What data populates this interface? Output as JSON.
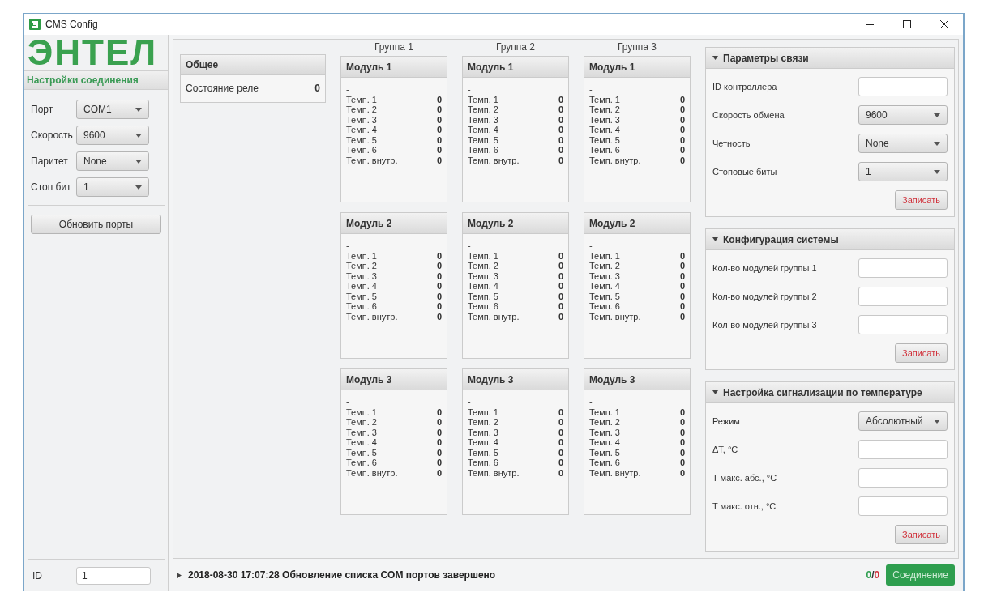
{
  "window": {
    "title": "CMS Config"
  },
  "logo": "ЭНТЕЛ",
  "connection": {
    "title": "Настройки соединения",
    "fields": [
      {
        "label": "Порт",
        "value": "COM1"
      },
      {
        "label": "Скорость",
        "value": "9600"
      },
      {
        "label": "Паритет",
        "value": "None"
      },
      {
        "label": "Стоп бит",
        "value": "1"
      }
    ],
    "refresh_button": "Обновить порты",
    "id_label": "ID",
    "id_value": "1"
  },
  "general": {
    "title": "Общее",
    "rows": [
      {
        "label": "Состояние реле",
        "value": "0"
      }
    ]
  },
  "groups": [
    {
      "title": "Группа 1",
      "modules": [
        {
          "title": "Модуль 1",
          "status": "-",
          "readings": [
            {
              "label": "Темп. 1",
              "value": "0"
            },
            {
              "label": "Темп. 2",
              "value": "0"
            },
            {
              "label": "Темп. 3",
              "value": "0"
            },
            {
              "label": "Темп. 4",
              "value": "0"
            },
            {
              "label": "Темп. 5",
              "value": "0"
            },
            {
              "label": "Темп. 6",
              "value": "0"
            },
            {
              "label": "Темп. внутр.",
              "value": "0"
            }
          ]
        },
        {
          "title": "Модуль 2",
          "status": "-",
          "readings": [
            {
              "label": "Темп. 1",
              "value": "0"
            },
            {
              "label": "Темп. 2",
              "value": "0"
            },
            {
              "label": "Темп. 3",
              "value": "0"
            },
            {
              "label": "Темп. 4",
              "value": "0"
            },
            {
              "label": "Темп. 5",
              "value": "0"
            },
            {
              "label": "Темп. 6",
              "value": "0"
            },
            {
              "label": "Темп. внутр.",
              "value": "0"
            }
          ]
        },
        {
          "title": "Модуль 3",
          "status": "-",
          "readings": [
            {
              "label": "Темп. 1",
              "value": "0"
            },
            {
              "label": "Темп. 2",
              "value": "0"
            },
            {
              "label": "Темп. 3",
              "value": "0"
            },
            {
              "label": "Темп. 4",
              "value": "0"
            },
            {
              "label": "Темп. 5",
              "value": "0"
            },
            {
              "label": "Темп. 6",
              "value": "0"
            },
            {
              "label": "Темп. внутр.",
              "value": "0"
            }
          ]
        }
      ]
    },
    {
      "title": "Группа 2",
      "modules": [
        {
          "title": "Модуль 1",
          "status": "-",
          "readings": [
            {
              "label": "Темп. 1",
              "value": "0"
            },
            {
              "label": "Темп. 2",
              "value": "0"
            },
            {
              "label": "Темп. 3",
              "value": "0"
            },
            {
              "label": "Темп. 4",
              "value": "0"
            },
            {
              "label": "Темп. 5",
              "value": "0"
            },
            {
              "label": "Темп. 6",
              "value": "0"
            },
            {
              "label": "Темп. внутр.",
              "value": "0"
            }
          ]
        },
        {
          "title": "Модуль 2",
          "status": "-",
          "readings": [
            {
              "label": "Темп. 1",
              "value": "0"
            },
            {
              "label": "Темп. 2",
              "value": "0"
            },
            {
              "label": "Темп. 3",
              "value": "0"
            },
            {
              "label": "Темп. 4",
              "value": "0"
            },
            {
              "label": "Темп. 5",
              "value": "0"
            },
            {
              "label": "Темп. 6",
              "value": "0"
            },
            {
              "label": "Темп. внутр.",
              "value": "0"
            }
          ]
        },
        {
          "title": "Модуль 3",
          "status": "-",
          "readings": [
            {
              "label": "Темп. 1",
              "value": "0"
            },
            {
              "label": "Темп. 2",
              "value": "0"
            },
            {
              "label": "Темп. 3",
              "value": "0"
            },
            {
              "label": "Темп. 4",
              "value": "0"
            },
            {
              "label": "Темп. 5",
              "value": "0"
            },
            {
              "label": "Темп. 6",
              "value": "0"
            },
            {
              "label": "Темп. внутр.",
              "value": "0"
            }
          ]
        }
      ]
    },
    {
      "title": "Группа 3",
      "modules": [
        {
          "title": "Модуль 1",
          "status": "-",
          "readings": [
            {
              "label": "Темп. 1",
              "value": "0"
            },
            {
              "label": "Темп. 2",
              "value": "0"
            },
            {
              "label": "Темп. 3",
              "value": "0"
            },
            {
              "label": "Темп. 4",
              "value": "0"
            },
            {
              "label": "Темп. 5",
              "value": "0"
            },
            {
              "label": "Темп. 6",
              "value": "0"
            },
            {
              "label": "Темп. внутр.",
              "value": "0"
            }
          ]
        },
        {
          "title": "Модуль 2",
          "status": "-",
          "readings": [
            {
              "label": "Темп. 1",
              "value": "0"
            },
            {
              "label": "Темп. 2",
              "value": "0"
            },
            {
              "label": "Темп. 3",
              "value": "0"
            },
            {
              "label": "Темп. 4",
              "value": "0"
            },
            {
              "label": "Темп. 5",
              "value": "0"
            },
            {
              "label": "Темп. 6",
              "value": "0"
            },
            {
              "label": "Темп. внутр.",
              "value": "0"
            }
          ]
        },
        {
          "title": "Модуль 3",
          "status": "-",
          "readings": [
            {
              "label": "Темп. 1",
              "value": "0"
            },
            {
              "label": "Темп. 2",
              "value": "0"
            },
            {
              "label": "Темп. 3",
              "value": "0"
            },
            {
              "label": "Темп. 4",
              "value": "0"
            },
            {
              "label": "Темп. 5",
              "value": "0"
            },
            {
              "label": "Темп. 6",
              "value": "0"
            },
            {
              "label": "Темп. внутр.",
              "value": "0"
            }
          ]
        }
      ]
    }
  ],
  "panels": [
    {
      "title": "Параметры связи",
      "expanded": true,
      "fields": [
        {
          "kind": "input",
          "label": "ID контроллера"
        },
        {
          "kind": "select",
          "label": "Скорость обмена",
          "value": "9600"
        },
        {
          "kind": "select",
          "label": "Четность",
          "value": "None"
        },
        {
          "kind": "select",
          "label": "Стоповые биты",
          "value": "1"
        }
      ],
      "button": "Записать"
    },
    {
      "title": "Конфигурация системы",
      "expanded": true,
      "fields": [
        {
          "kind": "input",
          "label": "Кол-во модулей группы 1"
        },
        {
          "kind": "input",
          "label": "Кол-во модулей группы 2"
        },
        {
          "kind": "input",
          "label": "Кол-во модулей группы 3"
        }
      ],
      "button": "Записать"
    },
    {
      "title": "Настройка сигнализации по температуре",
      "expanded": true,
      "fields": [
        {
          "kind": "select",
          "label": "Режим",
          "value": "Абсолютный"
        },
        {
          "kind": "input",
          "label": "ΔT, °C"
        },
        {
          "kind": "input",
          "label": "T макс. абс., °C"
        },
        {
          "kind": "input",
          "label": "T макс. отн., °C"
        }
      ],
      "button": "Записать"
    }
  ],
  "status_bar": {
    "expanded": false,
    "message": "2018-08-30 17:07:28 Обновление списка COM портов завершено",
    "counter_good": "0",
    "counter_separator": "/",
    "counter_bad": "0",
    "connect_button": "Соединение"
  }
}
